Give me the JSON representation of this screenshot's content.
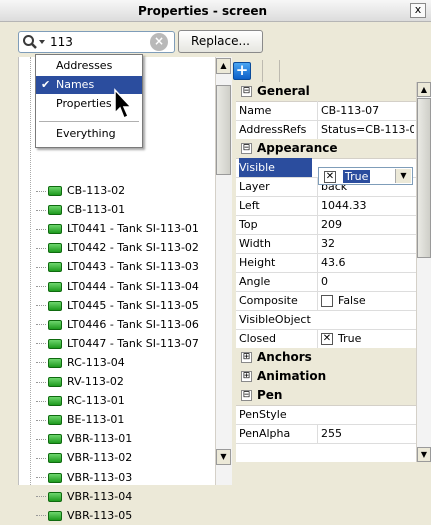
{
  "window": {
    "title": "Properties - screen",
    "close_label": "x"
  },
  "search": {
    "value": "113",
    "replace_label": "Replace..."
  },
  "search_menu": {
    "items": [
      {
        "label": "Addresses",
        "checked": false
      },
      {
        "label": "Names",
        "checked": true
      },
      {
        "label": "Properties",
        "checked": false
      },
      {
        "label": "Everything",
        "checked": false
      }
    ],
    "check_glyph": "✔"
  },
  "tree": {
    "items": [
      "CB-113-02",
      "CB-113-01",
      "LT0441 - Tank SI-113-01",
      "LT0442 - Tank SI-113-02",
      "LT0443 - Tank SI-113-03",
      "LT0444 - Tank SI-113-04",
      "LT0445 - Tank SI-113-05",
      "LT0446 - Tank SI-113-06",
      "LT0447 - Tank SI-113-07",
      "RC-113-04",
      "RV-113-02",
      "RC-113-01",
      "BE-113-01",
      "VBR-113-01",
      "VBR-113-02",
      "VBR-113-03",
      "VBR-113-04",
      "VBR-113-05"
    ]
  },
  "properties": {
    "toolbar_icon": "+",
    "general": {
      "header": "General",
      "toggle": "⊟",
      "rows": [
        {
          "key": "Name",
          "value": "CB-113-07"
        },
        {
          "key": "AddressRefs",
          "value": "Status=CB-113-0"
        }
      ]
    },
    "appearance": {
      "header": "Appearance",
      "toggle": "⊟",
      "visible_key": "Visible",
      "visible_value": "True",
      "rows": [
        {
          "key": "Layer",
          "value": "back"
        },
        {
          "key": "Left",
          "value": "1044.33"
        },
        {
          "key": "Top",
          "value": "209"
        },
        {
          "key": "Width",
          "value": "32"
        },
        {
          "key": "Height",
          "value": "43.6"
        },
        {
          "key": "Angle",
          "value": "0"
        }
      ],
      "composite_key": "Composite",
      "composite_value": "False",
      "visibleobject_key": "VisibleObject",
      "visibleobject_value": "",
      "closed_key": "Closed",
      "closed_value": "True"
    },
    "anchors": {
      "header": "Anchors",
      "toggle": "⊞"
    },
    "animation": {
      "header": "Animation",
      "toggle": "⊞"
    },
    "pen": {
      "header": "Pen",
      "toggle": "⊟",
      "rows": [
        {
          "key": "PenStyle",
          "value": ""
        },
        {
          "key": "PenAlpha",
          "value": "255"
        }
      ]
    }
  },
  "colors": {
    "selection": "#2b4d9e",
    "node_green": "#1e9a1e"
  }
}
